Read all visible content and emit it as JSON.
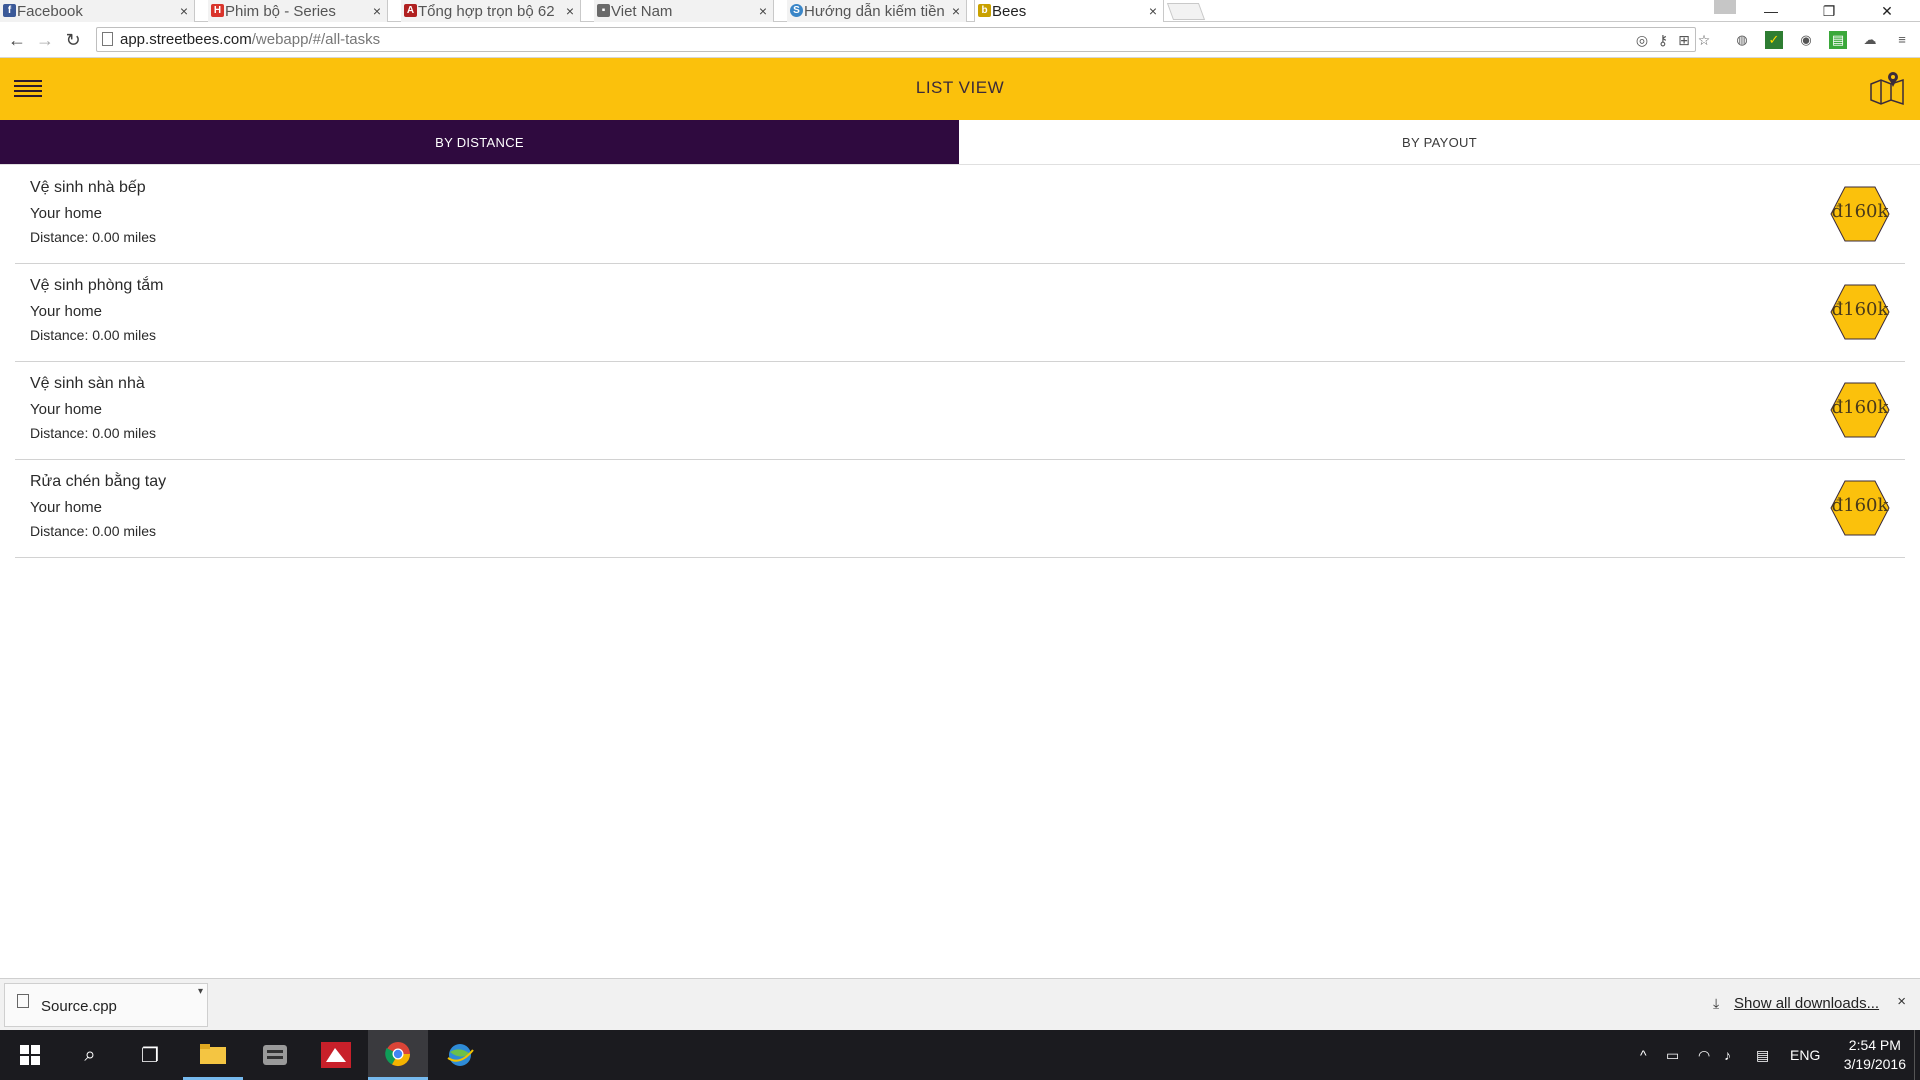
{
  "browser": {
    "tabs": [
      {
        "label": "Facebook",
        "favicon": "facebook-icon",
        "color": "#3b5998",
        "glyph": "f"
      },
      {
        "label": "Phim bộ - Series",
        "favicon": "phim-icon",
        "color": "#d9342b",
        "glyph": "H"
      },
      {
        "label": "Tổng hợp trọn bộ 62",
        "favicon": "red-a-icon",
        "color": "#b02020",
        "glyph": "A"
      },
      {
        "label": "Viet Nam",
        "favicon": "map-page-icon",
        "color": "#6a6a6a",
        "glyph": "▪"
      },
      {
        "label": "Hướng dẫn kiếm tiền",
        "favicon": "s-circle-icon",
        "color": "#3a86c8",
        "glyph": "S"
      },
      {
        "label": "Bees",
        "favicon": "bee-icon",
        "color": "#c9a100",
        "glyph": "b"
      }
    ],
    "tab_close_glyph": "×",
    "url_host": "app.streetbees.com",
    "url_path": "/webapp/#/all-tasks",
    "window_controls": {
      "minimize": "—",
      "restore": "❐",
      "close": "✕"
    }
  },
  "app": {
    "title": "LIST VIEW",
    "sort_tabs": {
      "by_distance": "BY DISTANCE",
      "by_payout": "BY PAYOUT"
    },
    "accent_color": "#fbc10c",
    "active_tab_color": "#2f0a3f",
    "tasks": [
      {
        "title": "Vệ sinh nhà bếp",
        "location": "Your home",
        "distance": "Distance: 0.00 miles",
        "payout": "đ160k"
      },
      {
        "title": "Vệ sinh phòng tắm",
        "location": "Your home",
        "distance": "Distance: 0.00 miles",
        "payout": "đ160k"
      },
      {
        "title": "Vệ sinh sàn nhà",
        "location": "Your home",
        "distance": "Distance: 0.00 miles",
        "payout": "đ160k"
      },
      {
        "title": "Rửa chén bằng tay",
        "location": "Your home",
        "distance": "Distance: 0.00 miles",
        "payout": "đ160k"
      }
    ]
  },
  "downloads": {
    "file_name": "Source.cpp",
    "show_all": "Show all downloads...",
    "close_glyph": "×"
  },
  "taskbar": {
    "language": "ENG",
    "time": "2:54 PM",
    "date": "3/19/2016"
  }
}
